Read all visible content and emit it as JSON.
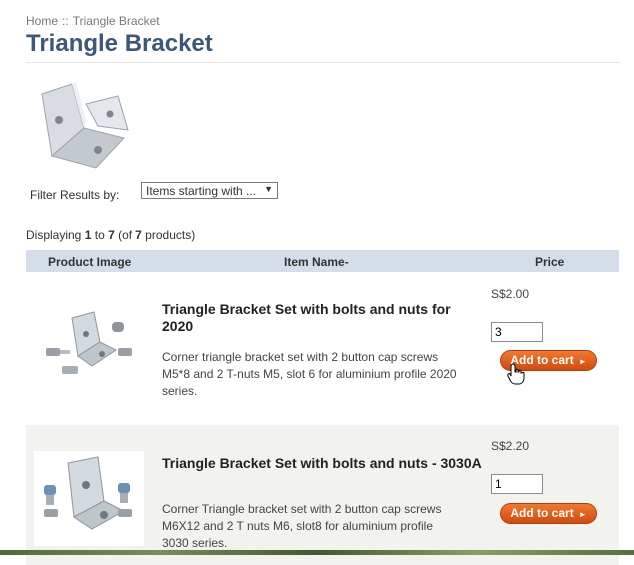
{
  "breadcrumb": {
    "home": "Home",
    "separator": "::",
    "current": "Triangle Bracket"
  },
  "page_title": "Triangle Bracket",
  "filter": {
    "label": "Filter Results by:",
    "selected": "Items starting with ..."
  },
  "displaying": {
    "prefix": "Displaying",
    "from": "1",
    "to_word": "to",
    "to": "7",
    "of_prefix": "(of",
    "total": "7",
    "suffix": "products)"
  },
  "table": {
    "headers": {
      "image": "Product Image",
      "name": "Item Name-",
      "price": "Price"
    }
  },
  "products": [
    {
      "name": "Triangle Bracket Set with bolts and nuts for 2020",
      "description": "Corner triangle bracket set with 2 button cap screws M5*8 and 2 T-nuts M5, slot 6 for aluminium profile 2020 series.",
      "price": "S$2.00",
      "quantity": "3",
      "button": "Add to cart"
    },
    {
      "name": "Triangle Bracket Set with bolts and nuts - 3030A",
      "description": "Corner Triangle bracket set with 2 button cap screws M6X12 and 2 T nuts M6, slot8 for aluminium profile 3030 series.",
      "price": "S$2.20",
      "quantity": "1",
      "button": "Add to cart"
    }
  ],
  "colors": {
    "title": "#3c5777",
    "header_bg": "#d5dde9",
    "button": "#e0601e",
    "alt_row": "#f2f3ee"
  }
}
